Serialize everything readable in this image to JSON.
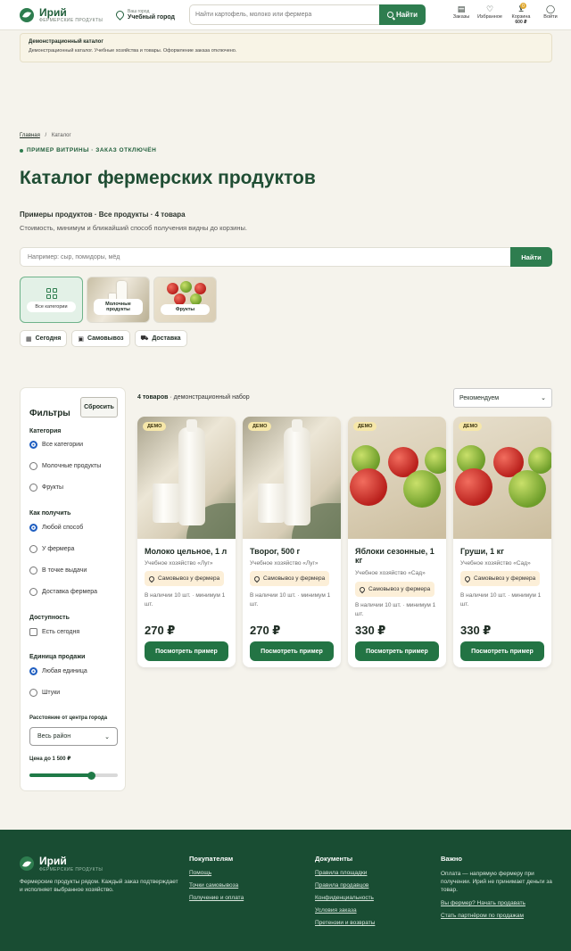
{
  "header": {
    "brand": "Ирий",
    "brand_sub": "ФЕРМЕРСКИЕ ПРОДУКТЫ",
    "city_label": "Ваш город",
    "city_value": "Учебный город",
    "search_placeholder": "Найти картофель, молоко или фермера",
    "search_button": "Найти",
    "nav": {
      "orders": "Заказы",
      "favorites": "Избранное",
      "cart": "Корзина",
      "cart_count": "0",
      "cart_sum": "600 ₽",
      "login": "Войти"
    }
  },
  "notice": {
    "title": "Демонстрационный каталог",
    "text": "Демонстрационный каталог. Учебные хозяйства и товары. Оформление заказа отключено."
  },
  "breadcrumb": {
    "home": "Главная",
    "sep": "/",
    "current": "Каталог"
  },
  "eyebrow": "ПРИМЕР ВИТРИНЫ · ЗАКАЗ ОТКЛЮЧЁН",
  "page_title": "Каталог фермерских продуктов",
  "subtitle": "Примеры продуктов · Все продукты · 4 товара",
  "subdesc": "Стоимость, минимум и ближайший способ получения видны до корзины.",
  "catalog_search": {
    "placeholder": "Например: сыр, помидоры, мёд",
    "button": "Найти"
  },
  "categories": [
    {
      "label": "Все категории"
    },
    {
      "label": "Молочные продукты"
    },
    {
      "label": "Фрукты"
    }
  ],
  "chips": [
    {
      "icon": "calendar-icon",
      "label": "Сегодня"
    },
    {
      "icon": "store-icon",
      "label": "Самовывоз"
    },
    {
      "icon": "truck-icon",
      "label": "Доставка"
    }
  ],
  "filters": {
    "title": "Фильтры",
    "reset": "Сбросить",
    "category_title": "Категория",
    "category_options": [
      "Все категории",
      "Молочные продукты",
      "Фрукты"
    ],
    "method_title": "Как получить",
    "method_options": [
      "Любой способ",
      "У фермера",
      "В точке выдачи",
      "Доставка фермера"
    ],
    "availability_title": "Доступность",
    "availability_option": "Есть сегодня",
    "unit_title": "Единица продажи",
    "unit_options": [
      "Любая единица",
      "Штуки"
    ],
    "distance_title": "Расстояние от центра города",
    "distance_value": "Весь район",
    "price_title": "Цена до 1 500 ₽",
    "price_fraction": 0.7
  },
  "results": {
    "count": "4 товаров",
    "rest": " · демонстрационный набор",
    "sort": "Рекомендуем"
  },
  "products": [
    {
      "badge": "ДЕМО",
      "name": "Молоко цельное, 1 л",
      "farm": "Учебное хозяйство «Луг»",
      "pickup": "Самовывоз у фермера",
      "stock": "В наличии 10 шт. · минимум 1 шт.",
      "price": "270 ₽",
      "button": "Посмотреть пример"
    },
    {
      "badge": "ДЕМО",
      "name": "Творог, 500 г",
      "farm": "Учебное хозяйство «Луг»",
      "pickup": "Самовывоз у фермера",
      "stock": "В наличии 10 шт. · минимум 1 шт.",
      "price": "270 ₽",
      "button": "Посмотреть пример"
    },
    {
      "badge": "ДЕМО",
      "name": "Яблоки сезонные, 1 кг",
      "farm": "Учебное хозяйство «Сад»",
      "pickup": "Самовывоз у фермера",
      "stock": "В наличии 10 шт. · минимум 1 шт.",
      "price": "330 ₽",
      "button": "Посмотреть пример"
    },
    {
      "badge": "ДЕМО",
      "name": "Груши, 1 кг",
      "farm": "Учебное хозяйство «Сад»",
      "pickup": "Самовывоз у фермера",
      "stock": "В наличии 10 шт. · минимум 1 шт.",
      "price": "330 ₽",
      "button": "Посмотреть пример"
    }
  ],
  "footer": {
    "brand": "Ирий",
    "brand_sub": "ФЕРМЕРСКИЕ ПРОДУКТЫ",
    "about": "Фермерские продукты рядом. Каждый заказ подтверждает и исполняет выбранное хозяйство.",
    "buyers_title": "Покупателям",
    "buyers_links": [
      "Помощь",
      "Точки самовывоза",
      "Получение и оплата"
    ],
    "docs_title": "Документы",
    "docs_links": [
      "Правила площадки",
      "Правила продавцов",
      "Конфиденциальность",
      "Условия заказа",
      "Претензии и возвраты"
    ],
    "important_title": "Важно",
    "important_text": "Оплата — напрямую фермеру при получении. Ирий не принимает деньги за товар.",
    "important_links": [
      "Вы фермер? Начать продавать",
      "Стать партнёром по продажам"
    ]
  }
}
